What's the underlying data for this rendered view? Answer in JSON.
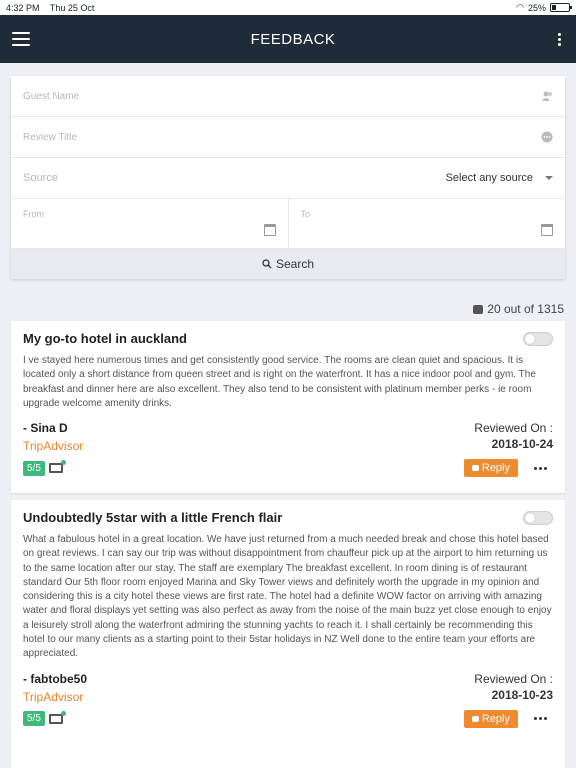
{
  "status": {
    "time": "4:32 PM",
    "date": "Thu 25 Oct",
    "battery": "25%",
    "battery_level": 0.25
  },
  "appbar": {
    "title": "FEEDBACK"
  },
  "form": {
    "guest_name_placeholder": "Guest Name",
    "review_title_placeholder": "Review Title",
    "source_label": "Source",
    "source_value": "Select any source",
    "from_label": "From",
    "to_label": "To",
    "search_label": "Search"
  },
  "count": "20 out of 1315",
  "reviews": [
    {
      "title": "My go-to hotel in auckland",
      "body": "I ve stayed here numerous times and get consistently good service. The rooms are clean quiet and spacious. It is located only a short distance from queen street and is right on the waterfront. It has a nice indoor pool and gym. The breakfast and dinner here are also excellent. They also tend to be consistent with platinum member perks - ie room upgrade welcome amenity drinks.",
      "author": "- Sina D",
      "source": "TripAdvisor",
      "reviewed_label": "Reviewed On :",
      "date": "2018-10-24",
      "score": "5/5",
      "reply": "Reply"
    },
    {
      "title": "Undoubtedly 5star with a little French flair",
      "body": "What a fabulous hotel in a great location. We have just returned from a much needed break and chose this hotel based on great reviews. I can say our trip was without disappointment from chauffeur pick up at the airport to him returning us to the same location after our stay. The staff are exemplary The breakfast excellent. In room dining is of restaurant standard Our 5th floor room enjoyed Marina and Sky Tower views and definitely worth the upgrade in my opinion and considering this is a city hotel these views are first rate. The hotel had a definite WOW factor on arriving with amazing water and floral displays yet setting was also perfect as away from the noise of the main buzz yet close enough to enjoy a leisurely stroll along the waterfront admiring the stunning yachts to reach it. I shall certainly be recommending this hotel to our many clients as a starting point to their 5star holidays in NZ Well done to the entire team your efforts are appreciated.",
      "author": "- fabtobe50",
      "source": "TripAdvisor",
      "reviewed_label": "Reviewed On :",
      "date": "2018-10-23",
      "score": "5/5",
      "reply": "Reply"
    }
  ]
}
